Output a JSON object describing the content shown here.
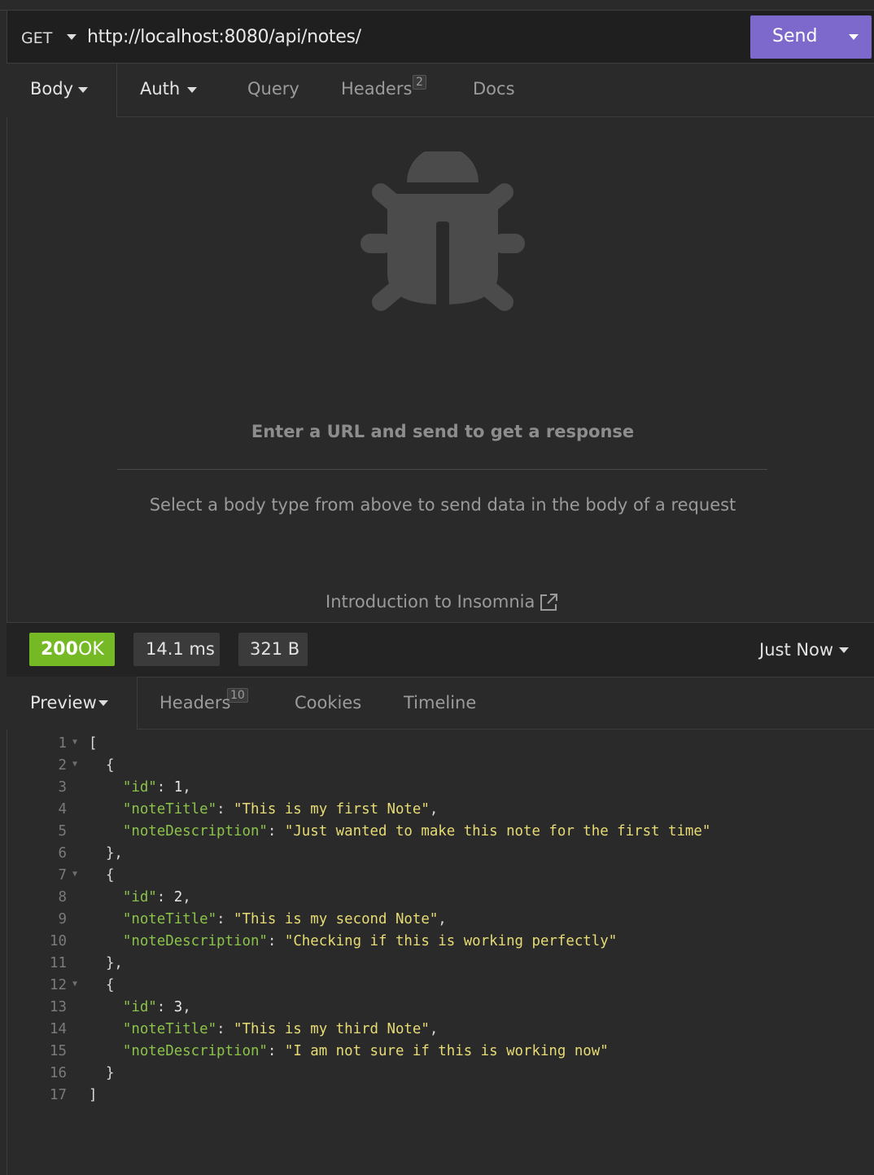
{
  "request": {
    "method": "GET",
    "url": "http://localhost:8080/api/notes/",
    "send_label": "Send"
  },
  "request_tabs": {
    "body": "Body",
    "auth": "Auth",
    "query": "Query",
    "headers": "Headers",
    "headers_count": "2",
    "docs": "Docs"
  },
  "empty_state": {
    "icon": "bug-icon",
    "title": "Enter a URL and send to get a response",
    "hint": "Select a body type from above to send data in the body of a request",
    "link": "Introduction to Insomnia",
    "link_icon": "external-link-icon"
  },
  "response": {
    "status_code": "200",
    "status_text": "OK",
    "time": "14.1 ms",
    "size": "321 B",
    "history": "Just Now",
    "status_color": "#75ba24"
  },
  "response_tabs": {
    "preview": "Preview",
    "headers": "Headers",
    "headers_count": "10",
    "cookies": "Cookies",
    "timeline": "Timeline"
  },
  "code_lines": [
    {
      "n": "1",
      "fold": true,
      "indent": 0,
      "parts": [
        [
          "p",
          "["
        ]
      ]
    },
    {
      "n": "2",
      "fold": true,
      "indent": 2,
      "parts": [
        [
          "p",
          "{"
        ]
      ]
    },
    {
      "n": "3",
      "fold": false,
      "indent": 4,
      "parts": [
        [
          "k",
          "\"id\""
        ],
        [
          "p",
          ": "
        ],
        [
          "n",
          "1"
        ],
        [
          "p",
          ","
        ]
      ]
    },
    {
      "n": "4",
      "fold": false,
      "indent": 4,
      "parts": [
        [
          "k",
          "\"noteTitle\""
        ],
        [
          "p",
          ": "
        ],
        [
          "s",
          "\"This is my first Note\""
        ],
        [
          "p",
          ","
        ]
      ]
    },
    {
      "n": "5",
      "fold": false,
      "indent": 4,
      "parts": [
        [
          "k",
          "\"noteDescription\""
        ],
        [
          "p",
          ": "
        ],
        [
          "s",
          "\"Just wanted to make this note for the first time\""
        ]
      ]
    },
    {
      "n": "6",
      "fold": false,
      "indent": 2,
      "parts": [
        [
          "p",
          "},"
        ]
      ]
    },
    {
      "n": "7",
      "fold": true,
      "indent": 2,
      "parts": [
        [
          "p",
          "{"
        ]
      ]
    },
    {
      "n": "8",
      "fold": false,
      "indent": 4,
      "parts": [
        [
          "k",
          "\"id\""
        ],
        [
          "p",
          ": "
        ],
        [
          "n",
          "2"
        ],
        [
          "p",
          ","
        ]
      ]
    },
    {
      "n": "9",
      "fold": false,
      "indent": 4,
      "parts": [
        [
          "k",
          "\"noteTitle\""
        ],
        [
          "p",
          ": "
        ],
        [
          "s",
          "\"This is my second Note\""
        ],
        [
          "p",
          ","
        ]
      ]
    },
    {
      "n": "10",
      "fold": false,
      "indent": 4,
      "parts": [
        [
          "k",
          "\"noteDescription\""
        ],
        [
          "p",
          ": "
        ],
        [
          "s",
          "\"Checking if this is working perfectly\""
        ]
      ]
    },
    {
      "n": "11",
      "fold": false,
      "indent": 2,
      "parts": [
        [
          "p",
          "},"
        ]
      ]
    },
    {
      "n": "12",
      "fold": true,
      "indent": 2,
      "parts": [
        [
          "p",
          "{"
        ]
      ]
    },
    {
      "n": "13",
      "fold": false,
      "indent": 4,
      "parts": [
        [
          "k",
          "\"id\""
        ],
        [
          "p",
          ": "
        ],
        [
          "n",
          "3"
        ],
        [
          "p",
          ","
        ]
      ]
    },
    {
      "n": "14",
      "fold": false,
      "indent": 4,
      "parts": [
        [
          "k",
          "\"noteTitle\""
        ],
        [
          "p",
          ": "
        ],
        [
          "s",
          "\"This is my third Note\""
        ],
        [
          "p",
          ","
        ]
      ]
    },
    {
      "n": "15",
      "fold": false,
      "indent": 4,
      "parts": [
        [
          "k",
          "\"noteDescription\""
        ],
        [
          "p",
          ": "
        ],
        [
          "s",
          "\"I am not sure if this is working now\""
        ]
      ]
    },
    {
      "n": "16",
      "fold": false,
      "indent": 2,
      "parts": [
        [
          "p",
          "}"
        ]
      ]
    },
    {
      "n": "17",
      "fold": false,
      "indent": 0,
      "parts": [
        [
          "p",
          "]"
        ]
      ]
    }
  ]
}
